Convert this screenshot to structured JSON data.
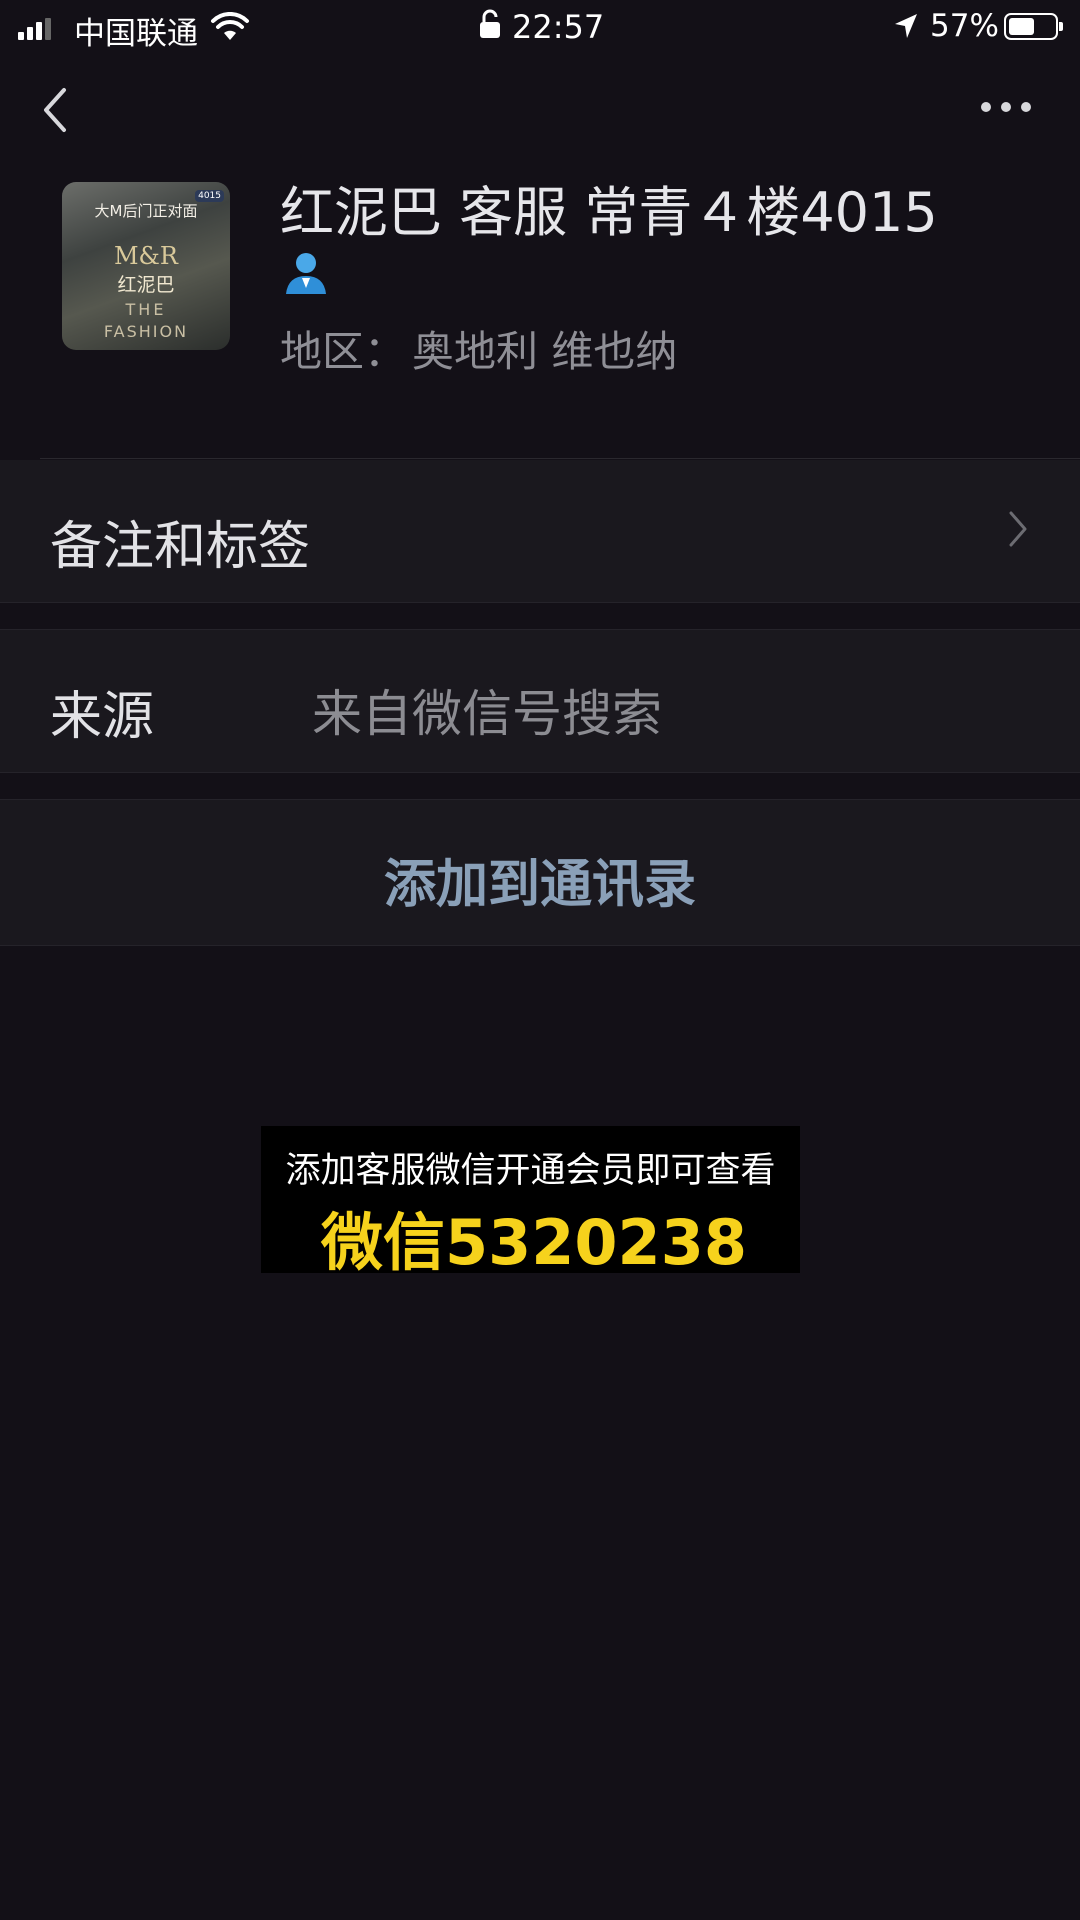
{
  "status_bar": {
    "carrier": "中国联通",
    "time": "22:57",
    "battery": "57%",
    "battery_level": 0.57
  },
  "profile": {
    "name": "红泥巴 客服 常青４楼4015",
    "region_label": "地区：",
    "region_value": "奥地利 维也纳",
    "avatar": {
      "top_text": "大M后门正对面",
      "brand": "M&R",
      "name": "红泥巴",
      "line1": "THE",
      "line2": "FASHION",
      "tag": "4015"
    }
  },
  "rows": {
    "remarks_label": "备注和标签",
    "source_label": "来源",
    "source_value": "来自微信号搜索",
    "add_button": "添加到通讯录"
  },
  "promo": {
    "line1": "添加客服微信开通会员即可查看",
    "line2": "微信5320238"
  },
  "colors": {
    "background": "#131017",
    "row": "#1a181e",
    "link": "#8aa0b8",
    "promo_highlight": "#f6d21c"
  }
}
